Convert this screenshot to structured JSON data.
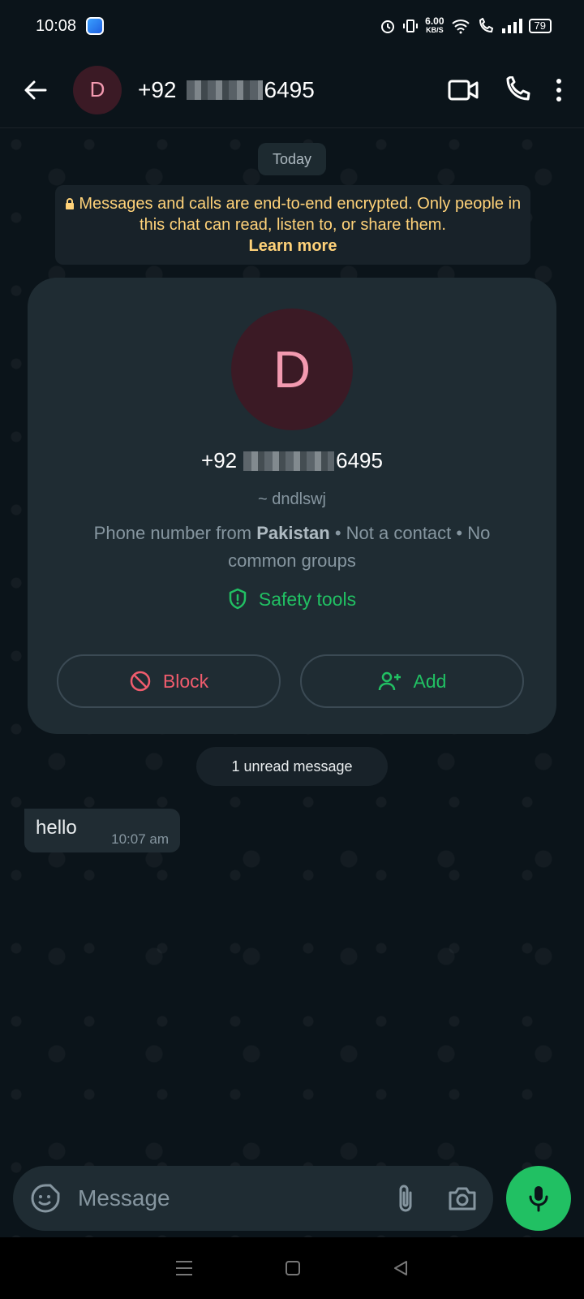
{
  "status_bar": {
    "time": "10:08",
    "speed_value": "6.00",
    "speed_unit": "KB/S",
    "battery": "79"
  },
  "header": {
    "avatar_letter": "D",
    "number_prefix": "+92",
    "number_suffix": "6495"
  },
  "chat": {
    "date_chip": "Today",
    "encryption_notice": "Messages and calls are end-to-end encrypted. Only people in this chat can read, listen to, or share them.",
    "learn_more": "Learn more",
    "card": {
      "avatar_letter": "D",
      "number_prefix": "+92",
      "number_suffix": "6495",
      "username": "~ dndlswj",
      "info_prefix": "Phone number from",
      "info_country": "Pakistan",
      "info_suffix": "• Not a contact • No common groups",
      "safety_tools": "Safety tools",
      "block_label": "Block",
      "add_label": "Add"
    },
    "unread_chip": "1 unread message",
    "messages": [
      {
        "text": "hello",
        "time": "10:07 am"
      }
    ]
  },
  "composer": {
    "placeholder": "Message"
  },
  "colors": {
    "accent_green": "#21c063",
    "block_red": "#f15c6d",
    "notice_yellow": "#ffd279",
    "avatar_bg": "#3b1a25",
    "avatar_fg": "#f39ab0"
  }
}
